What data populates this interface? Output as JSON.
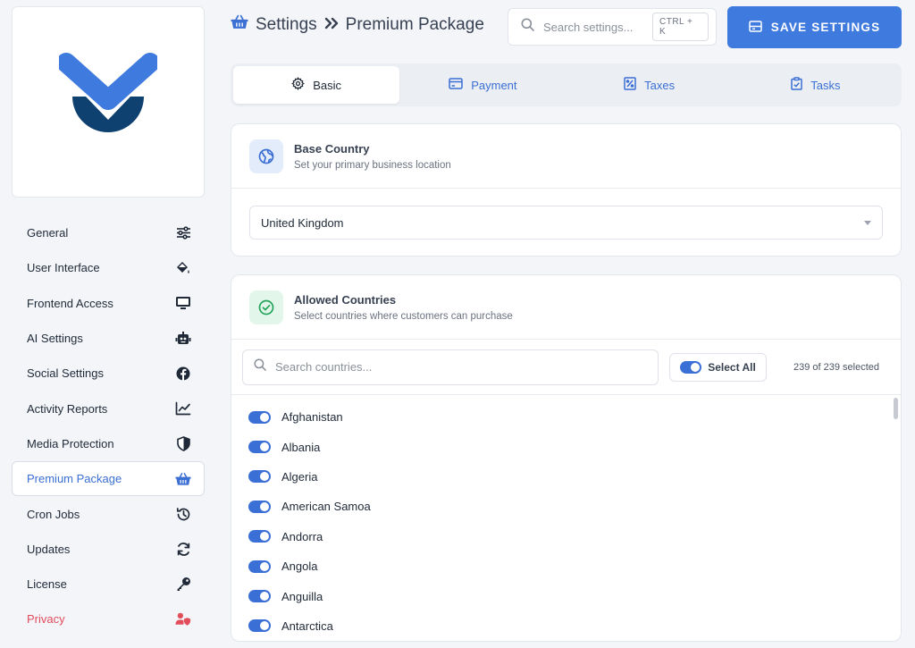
{
  "sidebar": {
    "items": [
      {
        "label": "General",
        "icon": "sliders-icon"
      },
      {
        "label": "User Interface",
        "icon": "paint-bucket-icon"
      },
      {
        "label": "Frontend Access",
        "icon": "monitor-icon"
      },
      {
        "label": "AI Settings",
        "icon": "robot-icon"
      },
      {
        "label": "Social Settings",
        "icon": "facebook-icon"
      },
      {
        "label": "Activity Reports",
        "icon": "line-chart-icon"
      },
      {
        "label": "Media Protection",
        "icon": "shield-icon"
      },
      {
        "label": "Premium Package",
        "icon": "basket-icon",
        "active": true
      },
      {
        "label": "Cron Jobs",
        "icon": "history-icon"
      },
      {
        "label": "Updates",
        "icon": "refresh-icon"
      },
      {
        "label": "License",
        "icon": "key-icon"
      },
      {
        "label": "Privacy",
        "icon": "user-shield-icon",
        "danger": true
      }
    ]
  },
  "header": {
    "title_part1": "Settings",
    "title_part2": "Premium Package",
    "search_placeholder": "Search settings...",
    "shortcut": "CTRL + K",
    "save_label": "SAVE SETTINGS"
  },
  "tabs": [
    {
      "label": "Basic",
      "icon": "gear-icon",
      "active": true
    },
    {
      "label": "Payment",
      "icon": "credit-card-icon"
    },
    {
      "label": "Taxes",
      "icon": "receipt-percent-icon"
    },
    {
      "label": "Tasks",
      "icon": "clipboard-check-icon"
    }
  ],
  "base_country": {
    "title": "Base Country",
    "subtitle": "Set your primary business location",
    "selected": "United Kingdom"
  },
  "allowed_countries": {
    "title": "Allowed Countries",
    "subtitle": "Select countries where customers can purchase",
    "search_placeholder": "Search countries...",
    "select_all_label": "Select All",
    "count_text": "239 of 239 selected",
    "countries": [
      "Afghanistan",
      "Albania",
      "Algeria",
      "American Samoa",
      "Andorra",
      "Angola",
      "Anguilla",
      "Antarctica"
    ]
  },
  "colors": {
    "accent": "#3f7ade",
    "danger": "#e24d5b",
    "logo_light": "#3f7ade",
    "logo_dark": "#0f4170"
  }
}
